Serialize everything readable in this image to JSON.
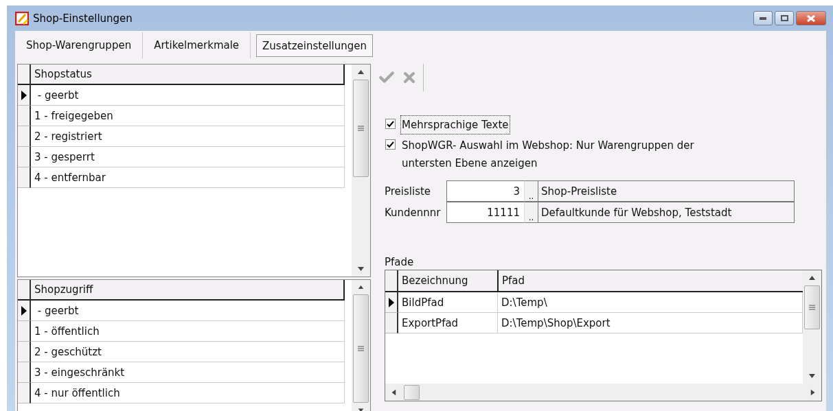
{
  "window": {
    "title": "Shop-Einstellungen"
  },
  "tabs": [
    {
      "label": "Shop-Warengruppen",
      "selected": false
    },
    {
      "label": "Artikelmerkmale",
      "selected": false
    },
    {
      "label": "Zusatzeinstellungen",
      "selected": true
    }
  ],
  "status_grid": {
    "header": "Shopstatus",
    "rows": [
      {
        "label": " - geerbt",
        "selected": true
      },
      {
        "label": "1 - freigegeben",
        "selected": false
      },
      {
        "label": "2 - registriert",
        "selected": false
      },
      {
        "label": "3 - gesperrt",
        "selected": false
      },
      {
        "label": "4 - entfernbar",
        "selected": false
      }
    ]
  },
  "access_grid": {
    "header": "Shopzugriff",
    "rows": [
      {
        "label": " - geerbt",
        "selected": true
      },
      {
        "label": "1 - öffentlich",
        "selected": false
      },
      {
        "label": "2 - geschützt",
        "selected": false
      },
      {
        "label": "3 - eingeschränkt",
        "selected": false
      },
      {
        "label": "4 - nur öffentlich",
        "selected": false
      }
    ]
  },
  "toolbar": [
    {
      "kind": "confirm",
      "disabled": true
    },
    {
      "kind": "cancel",
      "disabled": true
    }
  ],
  "checkboxes": [
    {
      "label": "Mehrsprachige Texte",
      "checked": true,
      "focused": true
    },
    {
      "label": "ShopWGR- Auswahl im Webshop: Nur Warengruppen der untersten Ebene anzeigen",
      "checked": true,
      "focused": false
    }
  ],
  "fields": [
    {
      "label": "Preisliste",
      "value": "3",
      "button": "..",
      "description": "Shop-Preisliste"
    },
    {
      "label": "Kundennnr",
      "value": "11111",
      "button": "..",
      "description": "Defaultkunde für Webshop, Teststadt"
    }
  ],
  "paths": {
    "label": "Pfade",
    "columns": [
      "Bezeichnung",
      "Pfad"
    ],
    "rows": [
      {
        "name": "BildPfad",
        "path": "D:\\Temp\\",
        "selected": true
      },
      {
        "name": "ExportPfad",
        "path": "D:\\Temp\\Shop\\Export",
        "selected": false
      }
    ]
  }
}
